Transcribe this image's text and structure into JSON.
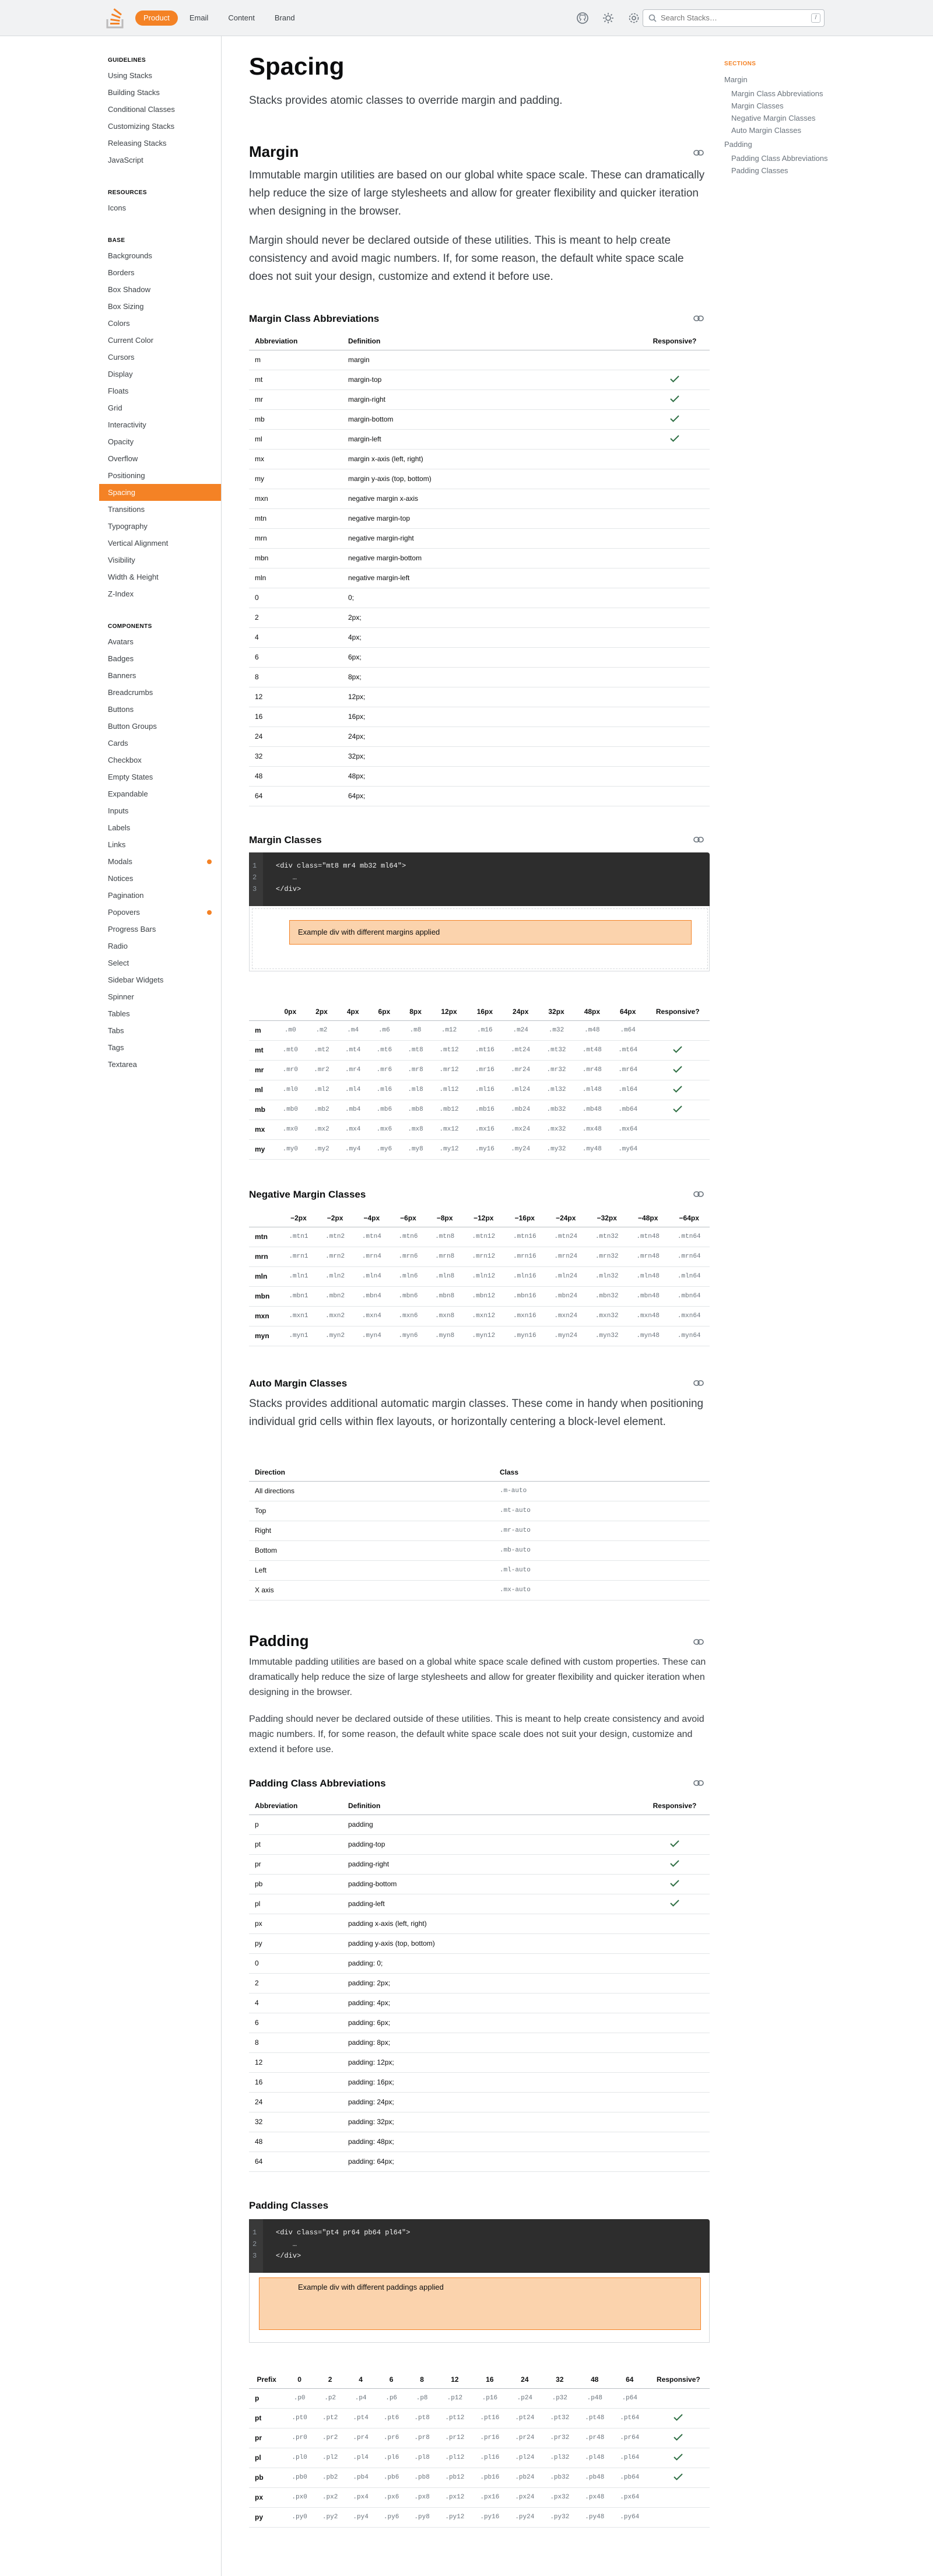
{
  "header": {
    "tabs": [
      {
        "label": "Product",
        "active": true
      },
      {
        "label": "Email"
      },
      {
        "label": "Content"
      },
      {
        "label": "Brand"
      }
    ],
    "search_placeholder": "Search Stacks…",
    "search_kbd": "/",
    "accent": "#f48225"
  },
  "sidebar": {
    "sections": [
      {
        "title": "GUIDELINES",
        "items": [
          "Using Stacks",
          "Building Stacks",
          "Conditional Classes",
          "Customizing Stacks",
          "Releasing Stacks",
          "JavaScript"
        ]
      },
      {
        "title": "RESOURCES",
        "items": [
          "Icons"
        ]
      },
      {
        "title": "BASE",
        "items": [
          "Backgrounds",
          "Borders",
          "Box Shadow",
          "Box Sizing",
          "Colors",
          "Current Color",
          "Cursors",
          "Display",
          "Floats",
          "Grid",
          "Interactivity",
          "Opacity",
          "Overflow",
          "Positioning",
          "Spacing",
          "Transitions",
          "Typography",
          "Vertical Alignment",
          "Visibility",
          "Width & Height",
          "Z-Index"
        ]
      },
      {
        "title": "COMPONENTS",
        "items": [
          "Avatars",
          "Badges",
          "Banners",
          "Breadcrumbs",
          "Buttons",
          "Button Groups",
          "Cards",
          "Checkbox",
          "Empty States",
          "Expandable",
          "Inputs",
          "Labels",
          "Links",
          "Modals",
          "Notices",
          "Pagination",
          "Popovers",
          "Progress Bars",
          "Radio",
          "Select",
          "Sidebar Widgets",
          "Spinner",
          "Tables",
          "Tabs",
          "Tags",
          "Textarea"
        ]
      }
    ],
    "active": "Spacing",
    "badged": [
      "Modals",
      "Popovers"
    ]
  },
  "page": {
    "title": "Spacing",
    "lede": "Stacks provides atomic classes to override margin and padding."
  },
  "margin": {
    "title": "Margin",
    "p1": "Immutable margin utilities are based on our global white space scale. These can dramatically help reduce the size of large stylesheets and allow for greater flexibility and quicker iteration when designing in the browser.",
    "p2": "Margin should never be declared outside of these utilities. This is meant to help create consistency and avoid magic numbers. If, for some reason, the default white space scale does not suit your design, customize and extend it before use.",
    "abbr_title": "Margin Class Abbreviations",
    "abbr_headers": [
      "Abbreviation",
      "Definition",
      "Responsive?"
    ],
    "abbr_rows": [
      [
        "m",
        "margin",
        false
      ],
      [
        "mt",
        "margin-top",
        true
      ],
      [
        "mr",
        "margin-right",
        true
      ],
      [
        "mb",
        "margin-bottom",
        true
      ],
      [
        "ml",
        "margin-left",
        true
      ],
      [
        "mx",
        "margin x-axis (left, right)",
        false
      ],
      [
        "my",
        "margin y-axis (top, bottom)",
        false
      ],
      [
        "mxn",
        "negative margin x-axis",
        false
      ],
      [
        "mtn",
        "negative margin-top",
        false
      ],
      [
        "mrn",
        "negative margin-right",
        false
      ],
      [
        "mbn",
        "negative margin-bottom",
        false
      ],
      [
        "mln",
        "negative margin-left",
        false
      ],
      [
        "0",
        "0;",
        false
      ],
      [
        "2",
        "2px;",
        false
      ],
      [
        "4",
        "4px;",
        false
      ],
      [
        "6",
        "6px;",
        false
      ],
      [
        "8",
        "8px;",
        false
      ],
      [
        "12",
        "12px;",
        false
      ],
      [
        "16",
        "16px;",
        false
      ],
      [
        "24",
        "24px;",
        false
      ],
      [
        "32",
        "32px;",
        false
      ],
      [
        "48",
        "48px;",
        false
      ],
      [
        "64",
        "64px;",
        false
      ]
    ],
    "classes_title": "Margin Classes",
    "code": [
      "<div class=\"mt8 mr4 mb32 ml64\">",
      "    …",
      "</div>"
    ],
    "example_label": "Example div with different margins applied",
    "grid_headers": [
      "",
      "0px",
      "2px",
      "4px",
      "6px",
      "8px",
      "12px",
      "16px",
      "24px",
      "32px",
      "48px",
      "64px",
      "Responsive?"
    ],
    "grid_rows": [
      {
        "p": "m",
        "c": [
          ".m0",
          ".m2",
          ".m4",
          ".m6",
          ".m8",
          ".m12",
          ".m16",
          ".m24",
          ".m32",
          ".m48",
          ".m64"
        ],
        "r": false
      },
      {
        "p": "mt",
        "c": [
          ".mt0",
          ".mt2",
          ".mt4",
          ".mt6",
          ".mt8",
          ".mt12",
          ".mt16",
          ".mt24",
          ".mt32",
          ".mt48",
          ".mt64"
        ],
        "r": true
      },
      {
        "p": "mr",
        "c": [
          ".mr0",
          ".mr2",
          ".mr4",
          ".mr6",
          ".mr8",
          ".mr12",
          ".mr16",
          ".mr24",
          ".mr32",
          ".mr48",
          ".mr64"
        ],
        "r": true
      },
      {
        "p": "ml",
        "c": [
          ".ml0",
          ".ml2",
          ".ml4",
          ".ml6",
          ".ml8",
          ".ml12",
          ".ml16",
          ".ml24",
          ".ml32",
          ".ml48",
          ".ml64"
        ],
        "r": true
      },
      {
        "p": "mb",
        "c": [
          ".mb0",
          ".mb2",
          ".mb4",
          ".mb6",
          ".mb8",
          ".mb12",
          ".mb16",
          ".mb24",
          ".mb32",
          ".mb48",
          ".mb64"
        ],
        "r": true
      },
      {
        "p": "mx",
        "c": [
          ".mx0",
          ".mx2",
          ".mx4",
          ".mx6",
          ".mx8",
          ".mx12",
          ".mx16",
          ".mx24",
          ".mx32",
          ".mx48",
          ".mx64"
        ],
        "r": false
      },
      {
        "p": "my",
        "c": [
          ".my0",
          ".my2",
          ".my4",
          ".my6",
          ".my8",
          ".my12",
          ".my16",
          ".my24",
          ".my32",
          ".my48",
          ".my64"
        ],
        "r": false
      }
    ],
    "neg_title": "Negative Margin Classes",
    "neg_headers": [
      "",
      "−2px",
      "−2px",
      "−4px",
      "−6px",
      "−8px",
      "−12px",
      "−16px",
      "−24px",
      "−32px",
      "−48px",
      "−64px"
    ],
    "neg_rows": [
      {
        "p": "mtn",
        "c": [
          ".mtn1",
          ".mtn2",
          ".mtn4",
          ".mtn6",
          ".mtn8",
          ".mtn12",
          ".mtn16",
          ".mtn24",
          ".mtn32",
          ".mtn48",
          ".mtn64"
        ]
      },
      {
        "p": "mrn",
        "c": [
          ".mrn1",
          ".mrn2",
          ".mrn4",
          ".mrn6",
          ".mrn8",
          ".mrn12",
          ".mrn16",
          ".mrn24",
          ".mrn32",
          ".mrn48",
          ".mrn64"
        ]
      },
      {
        "p": "mln",
        "c": [
          ".mln1",
          ".mln2",
          ".mln4",
          ".mln6",
          ".mln8",
          ".mln12",
          ".mln16",
          ".mln24",
          ".mln32",
          ".mln48",
          ".mln64"
        ]
      },
      {
        "p": "mbn",
        "c": [
          ".mbn1",
          ".mbn2",
          ".mbn4",
          ".mbn6",
          ".mbn8",
          ".mbn12",
          ".mbn16",
          ".mbn24",
          ".mbn32",
          ".mbn48",
          ".mbn64"
        ]
      },
      {
        "p": "mxn",
        "c": [
          ".mxn1",
          ".mxn2",
          ".mxn4",
          ".mxn6",
          ".mxn8",
          ".mxn12",
          ".mxn16",
          ".mxn24",
          ".mxn32",
          ".mxn48",
          ".mxn64"
        ]
      },
      {
        "p": "myn",
        "c": [
          ".myn1",
          ".myn2",
          ".myn4",
          ".myn6",
          ".myn8",
          ".myn12",
          ".myn16",
          ".myn24",
          ".myn32",
          ".myn48",
          ".myn64"
        ]
      }
    ],
    "auto_title": "Auto Margin Classes",
    "auto_p": "Stacks provides additional automatic margin classes. These come in handy when positioning individual grid cells within flex layouts, or horizontally centering a block-level element.",
    "auto_headers": [
      "Direction",
      "Class"
    ],
    "auto_rows": [
      [
        "All directions",
        ".m-auto"
      ],
      [
        "Top",
        ".mt-auto"
      ],
      [
        "Right",
        ".mr-auto"
      ],
      [
        "Bottom",
        ".mb-auto"
      ],
      [
        "Left",
        ".ml-auto"
      ],
      [
        "X axis",
        ".mx-auto"
      ]
    ]
  },
  "padding": {
    "title": "Padding",
    "p1": "Immutable padding utilities are based on a global white space scale defined with custom properties. These can dramatically help reduce the size of large stylesheets and allow for greater flexibility and quicker iteration when designing in the browser.",
    "p2": "Padding should never be declared outside of these utilities. This is meant to help create consistency and avoid magic numbers. If, for some reason, the default white space scale does not suit your design, customize and extend it before use.",
    "abbr_title": "Padding Class Abbreviations",
    "abbr_headers": [
      "Abbreviation",
      "Definition",
      "Responsive?"
    ],
    "abbr_rows": [
      [
        "p",
        "padding",
        false
      ],
      [
        "pt",
        "padding-top",
        true
      ],
      [
        "pr",
        "padding-right",
        true
      ],
      [
        "pb",
        "padding-bottom",
        true
      ],
      [
        "pl",
        "padding-left",
        true
      ],
      [
        "px",
        "padding x-axis (left, right)",
        false
      ],
      [
        "py",
        "padding y-axis (top, bottom)",
        false
      ],
      [
        "0",
        "padding: 0;",
        false
      ],
      [
        "2",
        "padding: 2px;",
        false
      ],
      [
        "4",
        "padding: 4px;",
        false
      ],
      [
        "6",
        "padding: 6px;",
        false
      ],
      [
        "8",
        "padding: 8px;",
        false
      ],
      [
        "12",
        "padding: 12px;",
        false
      ],
      [
        "16",
        "padding: 16px;",
        false
      ],
      [
        "24",
        "padding: 24px;",
        false
      ],
      [
        "32",
        "padding: 32px;",
        false
      ],
      [
        "48",
        "padding: 48px;",
        false
      ],
      [
        "64",
        "padding: 64px;",
        false
      ]
    ],
    "classes_title": "Padding Classes",
    "code": [
      "<div class=\"pt4 pr64 pb64 pl64\">",
      "    …",
      "</div>"
    ],
    "example_label": "Example div with different paddings applied",
    "grid_headers": [
      "Prefix",
      "0",
      "2",
      "4",
      "6",
      "8",
      "12",
      "16",
      "24",
      "32",
      "48",
      "64",
      "Responsive?"
    ],
    "grid_rows": [
      {
        "p": "p",
        "c": [
          ".p0",
          ".p2",
          ".p4",
          ".p6",
          ".p8",
          ".p12",
          ".p16",
          ".p24",
          ".p32",
          ".p48",
          ".p64"
        ],
        "r": false
      },
      {
        "p": "pt",
        "c": [
          ".pt0",
          ".pt2",
          ".pt4",
          ".pt6",
          ".pt8",
          ".pt12",
          ".pt16",
          ".pt24",
          ".pt32",
          ".pt48",
          ".pt64"
        ],
        "r": true
      },
      {
        "p": "pr",
        "c": [
          ".pr0",
          ".pr2",
          ".pr4",
          ".pr6",
          ".pr8",
          ".pr12",
          ".pr16",
          ".pr24",
          ".pr32",
          ".pr48",
          ".pr64"
        ],
        "r": true
      },
      {
        "p": "pl",
        "c": [
          ".pl0",
          ".pl2",
          ".pl4",
          ".pl6",
          ".pl8",
          ".pl12",
          ".pl16",
          ".pl24",
          ".pl32",
          ".pl48",
          ".pl64"
        ],
        "r": true
      },
      {
        "p": "pb",
        "c": [
          ".pb0",
          ".pb2",
          ".pb4",
          ".pb6",
          ".pb8",
          ".pb12",
          ".pb16",
          ".pb24",
          ".pb32",
          ".pb48",
          ".pb64"
        ],
        "r": true
      },
      {
        "p": "px",
        "c": [
          ".px0",
          ".px2",
          ".px4",
          ".px6",
          ".px8",
          ".px12",
          ".px16",
          ".px24",
          ".px32",
          ".px48",
          ".px64"
        ],
        "r": false
      },
      {
        "p": "py",
        "c": [
          ".py0",
          ".py2",
          ".py4",
          ".py6",
          ".py8",
          ".py12",
          ".py16",
          ".py24",
          ".py32",
          ".py48",
          ".py64"
        ],
        "r": false
      }
    ]
  },
  "toc": {
    "title": "SECTIONS",
    "items": [
      {
        "label": "Margin",
        "children": [
          "Margin Class Abbreviations",
          "Margin Classes",
          "Negative Margin Classes",
          "Auto Margin Classes"
        ]
      },
      {
        "label": "Padding",
        "children": [
          "Padding Class Abbreviations",
          "Padding Classes"
        ]
      }
    ]
  }
}
